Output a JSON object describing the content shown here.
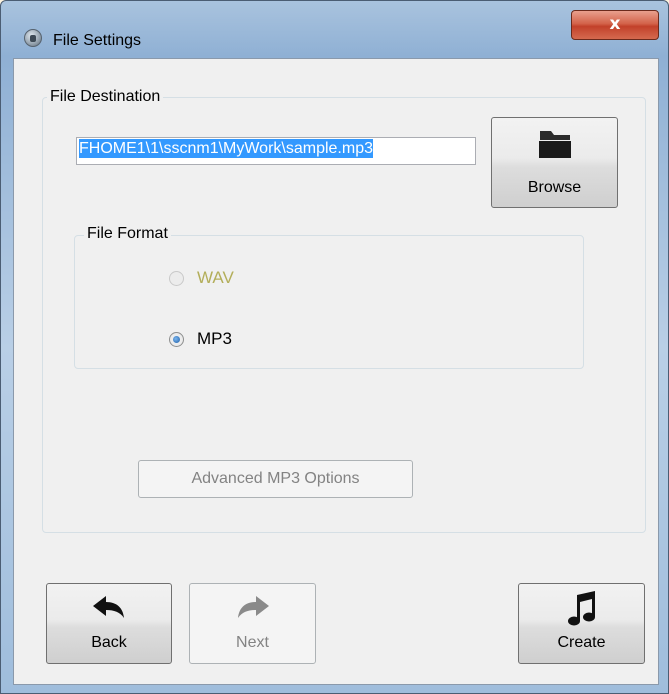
{
  "window": {
    "title": "File Settings",
    "icons": {
      "app": "headset-icon",
      "close": "close-icon"
    },
    "close_glyph": "x"
  },
  "destination": {
    "group_label": "File Destination",
    "path_value": "FHOME1\\1\\sscnm1\\MyWork\\sample.mp3",
    "browse_label": "Browse",
    "browse_icon": "folder-icon"
  },
  "format": {
    "group_label": "File Format",
    "options": [
      {
        "label": "WAV",
        "selected": false,
        "enabled": false
      },
      {
        "label": "MP3",
        "selected": true,
        "enabled": true
      }
    ]
  },
  "advanced_button": {
    "label": "Advanced MP3 Options",
    "enabled": false
  },
  "nav": {
    "back_label": "Back",
    "back_icon": "back-arrow-icon",
    "next_label": "Next",
    "next_icon": "forward-arrow-icon",
    "next_enabled": false,
    "create_label": "Create",
    "create_icon": "music-note-icon"
  },
  "colors": {
    "selection": "#3399ff",
    "disabled_text": "#838383",
    "wav_disabled_text": "#b3ae5a"
  }
}
